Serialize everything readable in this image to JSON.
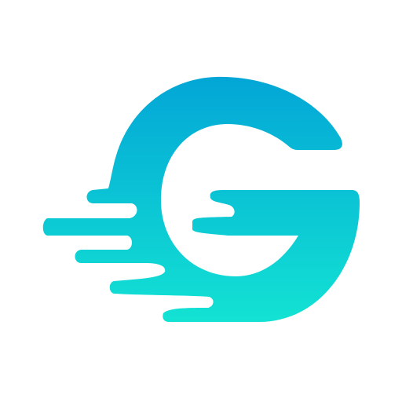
{
  "logo": {
    "icon": "speed-letter-g-logo-icon",
    "gradient_top_color": "#03A6D6",
    "gradient_bottom_color": "#13E3D3",
    "background_color": "#FFFFFF"
  }
}
